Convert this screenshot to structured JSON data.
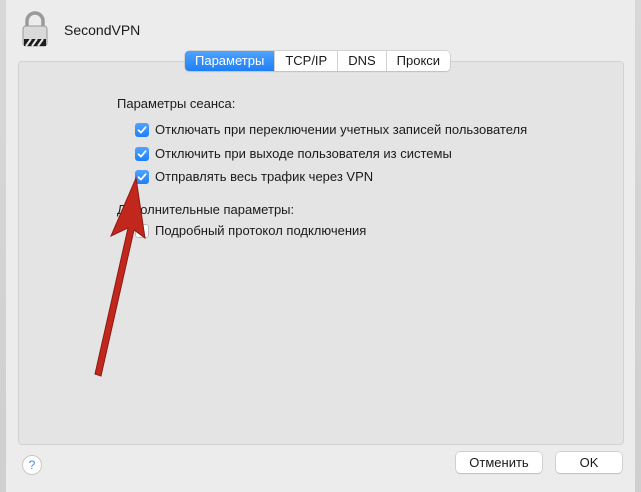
{
  "app": {
    "title": "SecondVPN",
    "icon": "lock-icon"
  },
  "tabs": [
    {
      "label": "Параметры",
      "active": true
    },
    {
      "label": "TCP/IP",
      "active": false
    },
    {
      "label": "DNS",
      "active": false
    },
    {
      "label": "Прокси",
      "active": false
    }
  ],
  "session": {
    "heading": "Параметры сеанса:",
    "options": [
      {
        "label": "Отключать при переключении учетных записей пользователя",
        "checked": true
      },
      {
        "label": "Отключить при выходе пользователя из системы",
        "checked": true
      },
      {
        "label": "Отправлять весь трафик через VPN",
        "checked": true
      }
    ]
  },
  "advanced": {
    "heading": "Дополнительные параметры:",
    "options": [
      {
        "label": "Подробный протокол подключения",
        "checked": false
      }
    ]
  },
  "footer": {
    "help_label": "?",
    "cancel_label": "Отменить",
    "ok_label": "OK"
  },
  "colors": {
    "accent": "#1e7ff5",
    "annotation_arrow": "#c1271d"
  }
}
